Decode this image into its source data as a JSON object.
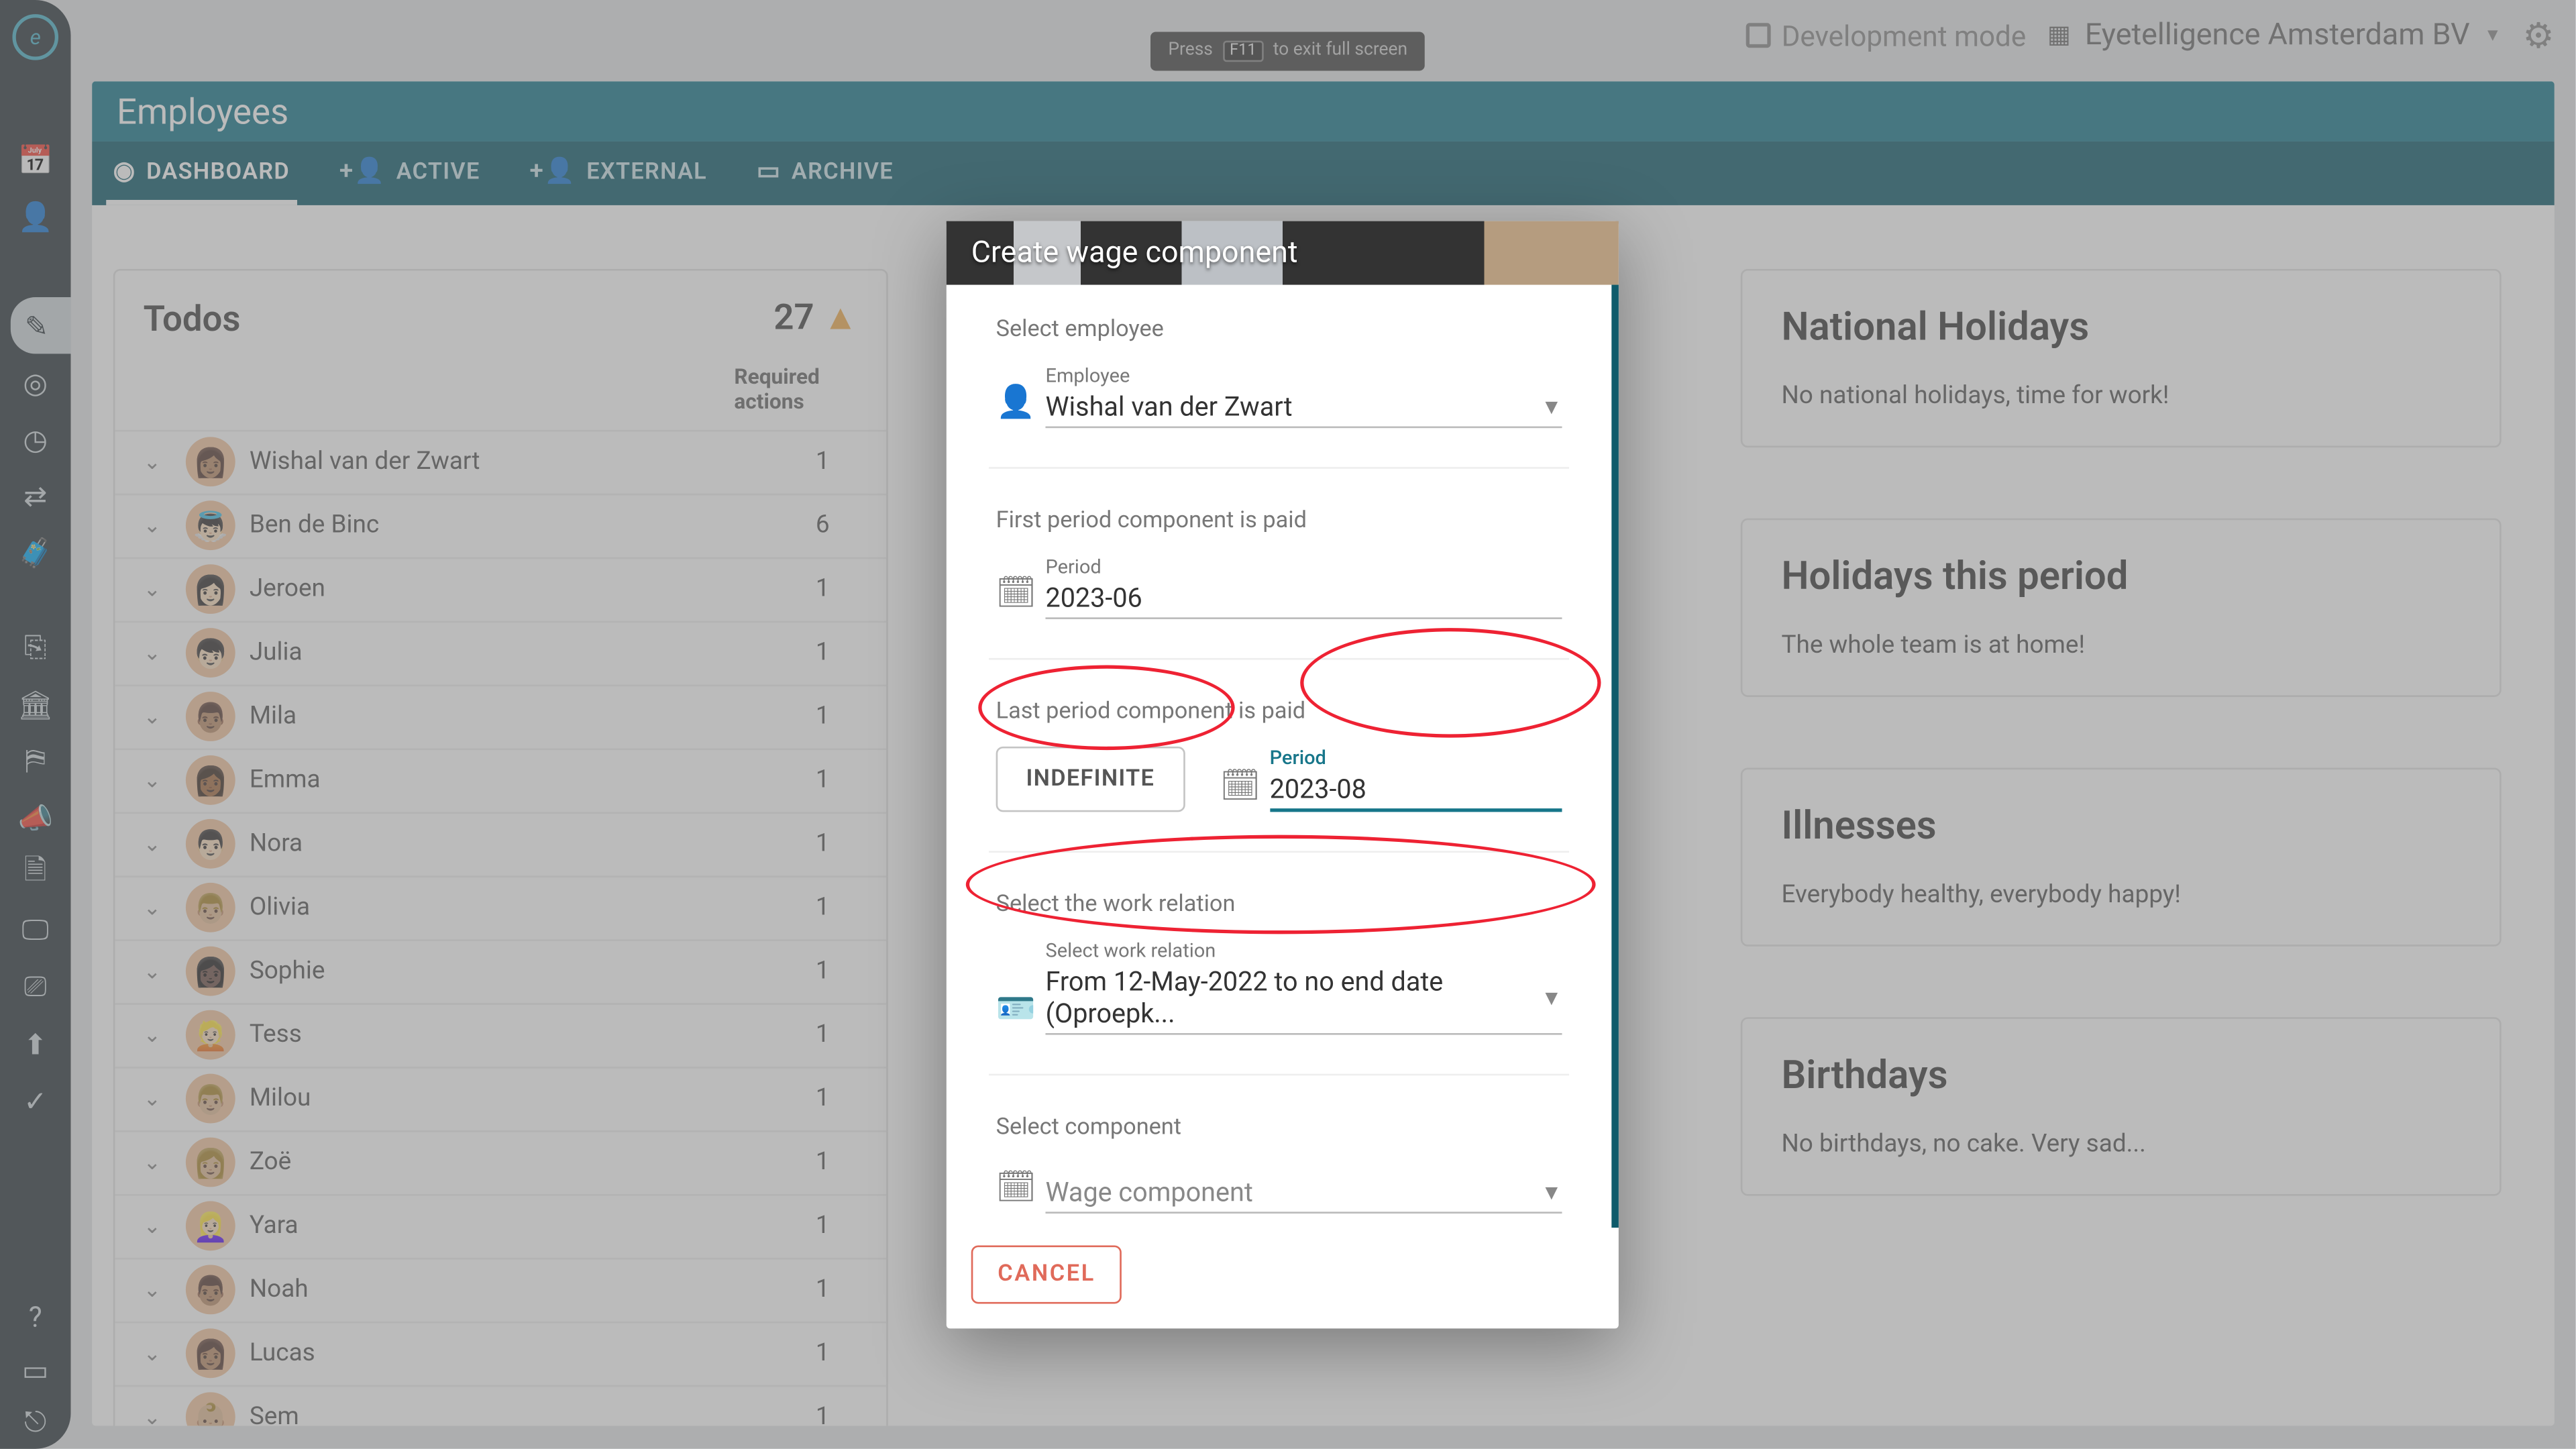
{
  "fullscreen_prompt": {
    "pre": "Press",
    "key": "F11",
    "post": "to exit full screen"
  },
  "topbar": {
    "dev_mode_label": "Development mode",
    "company_name": "Eyetelligence Amsterdam BV"
  },
  "page": {
    "title": "Employees"
  },
  "tabs": [
    {
      "label": "DASHBOARD",
      "icon": "⚫"
    },
    {
      "label": "ACTIVE",
      "icon": "+"
    },
    {
      "label": "EXTERNAL",
      "icon": "+"
    },
    {
      "label": "ARCHIVE",
      "icon": "▭"
    }
  ],
  "todos": {
    "title": "Todos",
    "count": "27",
    "column_label": "Required actions",
    "rows": [
      {
        "name": "Wishal van der Zwart",
        "count": "1",
        "emoji": "👩🏽"
      },
      {
        "name": "Ben de Binc",
        "count": "6",
        "emoji": "👼🏻"
      },
      {
        "name": "Jeroen",
        "count": "1",
        "emoji": "👩🏻"
      },
      {
        "name": "Julia",
        "count": "1",
        "emoji": "👦🏻"
      },
      {
        "name": "Mila",
        "count": "1",
        "emoji": "👨🏽"
      },
      {
        "name": "Emma",
        "count": "1",
        "emoji": "👩🏾"
      },
      {
        "name": "Nora",
        "count": "1",
        "emoji": "👨🏻"
      },
      {
        "name": "Olivia",
        "count": "1",
        "emoji": "👨🏼"
      },
      {
        "name": "Sophie",
        "count": "1",
        "emoji": "👩🏿"
      },
      {
        "name": "Tess",
        "count": "1",
        "emoji": "👱🏻"
      },
      {
        "name": "Milou",
        "count": "1",
        "emoji": "👨🏼"
      },
      {
        "name": "Zoë",
        "count": "1",
        "emoji": "👩🏼"
      },
      {
        "name": "Yara",
        "count": "1",
        "emoji": "👱🏻‍♀️"
      },
      {
        "name": "Noah",
        "count": "1",
        "emoji": "👨🏽"
      },
      {
        "name": "Lucas",
        "count": "1",
        "emoji": "👩🏽"
      },
      {
        "name": "Sem",
        "count": "1",
        "emoji": "👶🏼"
      }
    ]
  },
  "right_panels": {
    "holidays": {
      "title": "National Holidays",
      "body": "No national holidays, time for work!"
    },
    "period_holidays": {
      "title": "Holidays this period",
      "body": "The whole team is at home!"
    },
    "illness": {
      "title": "Illnesses",
      "body": "Everybody healthy, everybody happy!"
    },
    "birthdays": {
      "title": "Birthdays",
      "body": "No birthdays, no cake. Very sad..."
    }
  },
  "modal": {
    "title": "Create wage component",
    "sections": {
      "employee": {
        "title": "Select employee",
        "label": "Employee",
        "value": "Wishal van der Zwart"
      },
      "first_period": {
        "title": "First period component is paid",
        "label": "Period",
        "value": "2023-06"
      },
      "last_period": {
        "title": "Last period component is paid",
        "button": "INDEFINITE",
        "label": "Period",
        "value": "2023-08"
      },
      "work_relation": {
        "title": "Select the work relation",
        "label": "Select work relation",
        "value": "From 12-May-2022 to no end date (Oproepk..."
      },
      "component": {
        "title": "Select component",
        "label": "Wage component"
      }
    },
    "cancel": "CANCEL"
  }
}
